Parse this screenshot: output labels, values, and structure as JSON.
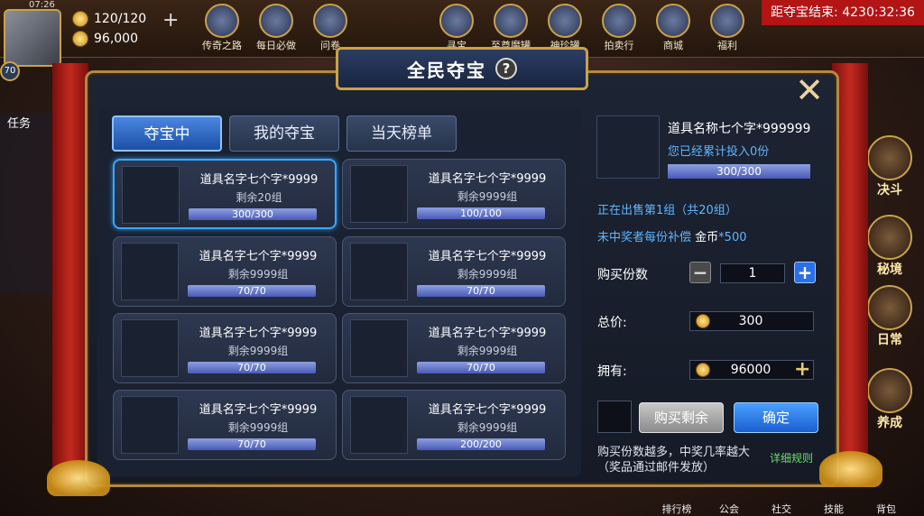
{
  "hud": {
    "time": "07:26",
    "level": "70",
    "stamina": "120/120",
    "gold": "96,000",
    "top_icons": [
      "传奇之路",
      "每日必做",
      "问卷",
      "寻宝",
      "至尊魔罐",
      "神珍罐",
      "拍卖行",
      "商城",
      "福利"
    ],
    "countdown": "距夺宝结束: 4230:32:36",
    "task_tab": "任务",
    "side_buttons": [
      "决斗",
      "秘境",
      "日常",
      "养成"
    ],
    "bottom_nav": [
      "排行榜",
      "公会",
      "社交",
      "技能",
      "背包"
    ]
  },
  "dialog": {
    "title": "全民夺宝",
    "help": "?",
    "tabs": [
      "夺宝中",
      "我的夺宝",
      "当天榜单"
    ],
    "active_tab": 0,
    "items": [
      {
        "name": "道具名字七个字*9999",
        "remain": "剩余20组",
        "progress": "300/300",
        "selected": true
      },
      {
        "name": "道具名字七个字*9999",
        "remain": "剩余9999组",
        "progress": "100/100",
        "selected": false
      },
      {
        "name": "道具名字七个字*9999",
        "remain": "剩余9999组",
        "progress": "70/70",
        "selected": false
      },
      {
        "name": "道具名字七个字*9999",
        "remain": "剩余9999组",
        "progress": "70/70",
        "selected": false
      },
      {
        "name": "道具名字七个字*9999",
        "remain": "剩余9999组",
        "progress": "70/70",
        "selected": false
      },
      {
        "name": "道具名字七个字*9999",
        "remain": "剩余9999组",
        "progress": "70/70",
        "selected": false
      },
      {
        "name": "道具名字七个字*9999",
        "remain": "剩余9999组",
        "progress": "70/70",
        "selected": false
      },
      {
        "name": "道具名字七个字*9999",
        "remain": "剩余9999组",
        "progress": "200/200",
        "selected": false
      }
    ],
    "detail": {
      "prize_name": "道具名称七个字*999999",
      "invested": "您已经累计投入0份",
      "progress": "300/300",
      "batch": "正在出售第1组（共20组）",
      "comp_prefix": "未中奖者每份补偿",
      "comp_currency": "金币",
      "comp_amount": "*500",
      "qty_label": "购买份数",
      "qty": "1",
      "total_label": "总价:",
      "total": "300",
      "own_label": "拥有:",
      "own": "96000",
      "buy_rest": "购买剩余",
      "confirm": "确定",
      "hint1": "购买份数越多，中奖几率越大",
      "hint2": "（奖品通过邮件发放）",
      "rules": "详细规则"
    }
  }
}
